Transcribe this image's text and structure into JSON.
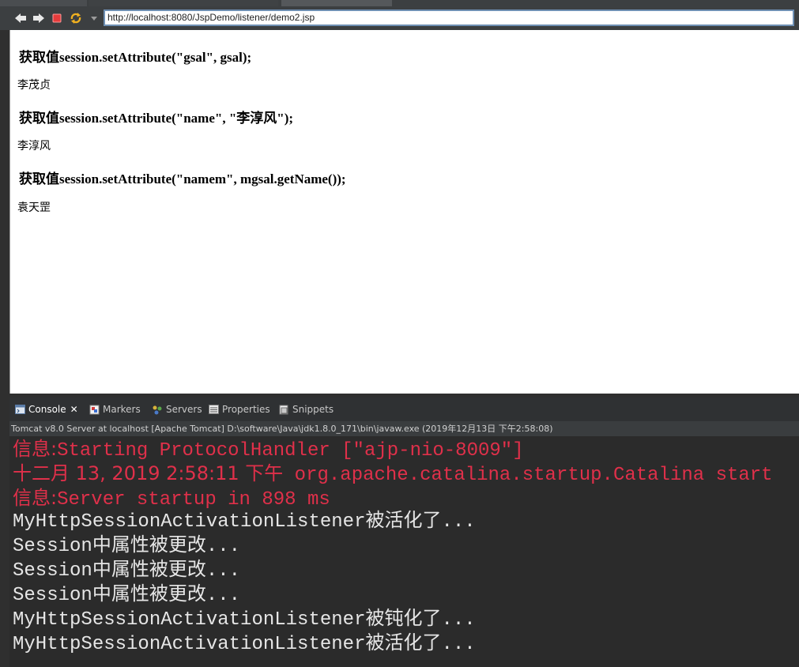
{
  "browser": {
    "url": "http://localhost:8080/JspDemo/listener/demo2.jsp"
  },
  "page": {
    "blocks": [
      {
        "heading": "获取值session.setAttribute(\"gsal\", gsal);",
        "value": "李茂贞"
      },
      {
        "heading": "获取值session.setAttribute(\"name\", \"李淳风\");",
        "value": "李淳风"
      },
      {
        "heading": "获取值session.setAttribute(\"namem\", mgsal.getName());",
        "value": "袁天罡"
      }
    ]
  },
  "views": {
    "tabs": [
      {
        "label": "Console",
        "icon": "console-icon",
        "active": true
      },
      {
        "label": "Markers",
        "icon": "markers-icon",
        "active": false
      },
      {
        "label": "Servers",
        "icon": "servers-icon",
        "active": false
      },
      {
        "label": "Properties",
        "icon": "properties-icon",
        "active": false
      },
      {
        "label": "Snippets",
        "icon": "snippets-icon",
        "active": false
      }
    ],
    "close_glyph": "✕"
  },
  "console": {
    "description": "Tomcat v8.0 Server at localhost [Apache Tomcat] D:\\software\\Java\\jdk1.8.0_171\\bin\\javaw.exe (2019年12月13日 下午2:58:08)",
    "lines": [
      {
        "prefix": "信息:",
        "text": "Starting ProtocolHandler [\"ajp-nio-8009\"]",
        "color": "red"
      },
      {
        "prefix": "十二月 13, 2019 2:58:11 下午",
        "text": " org.apache.catalina.startup.Catalina start",
        "color": "red"
      },
      {
        "prefix": "信息:",
        "text": "Server startup in 898 ms",
        "color": "red"
      },
      {
        "prefix": "",
        "text": "MyHttpSessionActivationListener被活化了...",
        "color": "white"
      },
      {
        "prefix": "",
        "text": "Session中属性被更改...",
        "color": "white"
      },
      {
        "prefix": "",
        "text": "Session中属性被更改...",
        "color": "white"
      },
      {
        "prefix": "",
        "text": "Session中属性被更改...",
        "color": "white"
      },
      {
        "prefix": "",
        "text": "MyHttpSessionActivationListener被钝化了...",
        "color": "white"
      },
      {
        "prefix": "",
        "text": "MyHttpSessionActivationListener被活化了...",
        "color": "white"
      }
    ]
  },
  "colors": {
    "error_red": "#e0304a",
    "console_text": "#e6e6e6",
    "console_bg": "#2b2b2b",
    "toolbar_bg": "#3c3f41"
  }
}
